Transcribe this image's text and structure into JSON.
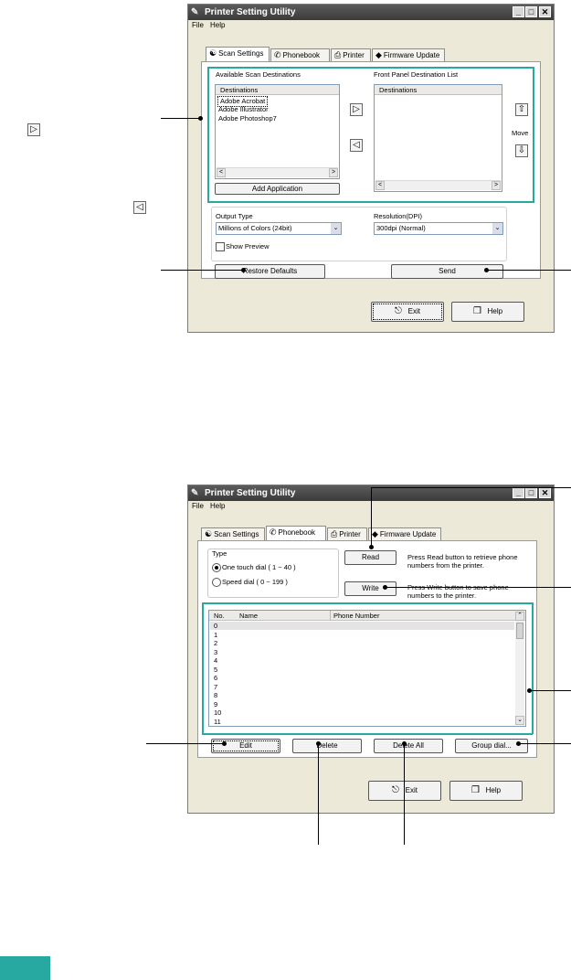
{
  "window1": {
    "title": "Printer Setting Utility",
    "menu": [
      "File",
      "Help"
    ],
    "tabs": [
      "Scan Settings",
      "Phonebook",
      "Printer",
      "Firmware Update"
    ],
    "available_label": "Available Scan Destinations",
    "front_panel_label": "Front Panel Destination List",
    "destinations_header": "Destinations",
    "available_items": [
      "Adobe Acrobat",
      "Adobe Illustrator",
      "Adobe Photoshop7"
    ],
    "move_label": "Move",
    "add_application": "Add Application",
    "output_type_label": "Output Type",
    "output_type_value": "Millions of Colors (24bit)",
    "resolution_label": "Resolution(DPI)",
    "resolution_value": "300dpi (Normal)",
    "show_preview": "Show Preview",
    "restore_defaults": "Restore Defaults",
    "send": "Send",
    "exit": "Exit",
    "help": "Help"
  },
  "window2": {
    "title": "Printer Setting Utility",
    "menu": [
      "File",
      "Help"
    ],
    "tabs": [
      "Scan Settings",
      "Phonebook",
      "Printer",
      "Firmware Update"
    ],
    "type_label": "Type",
    "one_touch": "One touch dial ( 1 ~ 40 )",
    "speed_dial": "Speed dial ( 0 ~ 199 )",
    "read": "Read",
    "read_desc_1": "Press Read button to retrieve phone",
    "read_desc_2": "numbers from the printer.",
    "write": "Write",
    "write_desc_1": "Press Write button to save phone",
    "write_desc_2": "numbers to the printer.",
    "col_no": "No.",
    "col_name": "Name",
    "col_phone": "Phone Number",
    "rows": [
      "0",
      "1",
      "2",
      "3",
      "4",
      "5",
      "6",
      "7",
      "8",
      "9",
      "10",
      "11"
    ],
    "edit": "Edit",
    "delete": "Delete",
    "delete_all": "Delete All",
    "group_dial": "Group dial...",
    "exit": "Exit",
    "help": "Help"
  },
  "accent_color": "#27a8a0"
}
